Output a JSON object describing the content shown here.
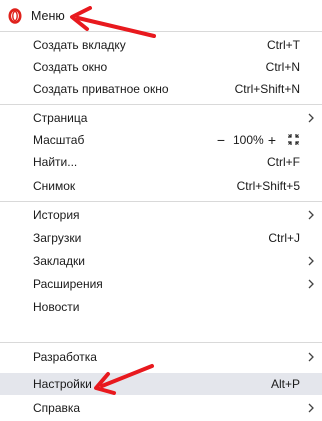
{
  "header": {
    "title": "Меню",
    "logo": "opera-logo-icon",
    "accent": "#e0211b"
  },
  "sections": [
    [
      {
        "id": "new-tab",
        "label": "Создать вкладку",
        "shortcut": "Ctrl+T"
      },
      {
        "id": "new-window",
        "label": "Создать окно",
        "shortcut": "Ctrl+N"
      },
      {
        "id": "new-private-window",
        "label": "Создать приватное окно",
        "shortcut": "Ctrl+Shift+N"
      }
    ],
    [
      {
        "id": "page",
        "label": "Страница",
        "submenu": true
      },
      {
        "id": "zoom",
        "label": "Масштаб",
        "zoom": {
          "minus": "−",
          "value": "100%",
          "plus": "+"
        }
      },
      {
        "id": "find",
        "label": "Найти...",
        "shortcut": "Ctrl+F"
      },
      {
        "id": "snapshot",
        "label": "Снимок",
        "shortcut": "Ctrl+Shift+5"
      }
    ],
    [
      {
        "id": "history",
        "label": "История",
        "submenu": true
      },
      {
        "id": "downloads",
        "label": "Загрузки",
        "shortcut": "Ctrl+J"
      },
      {
        "id": "bookmarks",
        "label": "Закладки",
        "submenu": true
      },
      {
        "id": "extensions",
        "label": "Расширения",
        "submenu": true
      },
      {
        "id": "news",
        "label": "Новости"
      }
    ],
    [
      {
        "id": "developer",
        "label": "Разработка",
        "submenu": true
      },
      {
        "id": "settings",
        "label": "Настройки",
        "shortcut": "Alt+P",
        "highlighted": true
      },
      {
        "id": "help",
        "label": "Справка",
        "submenu": true
      }
    ]
  ],
  "annotations": {
    "arrow_color": "#e8191e"
  }
}
